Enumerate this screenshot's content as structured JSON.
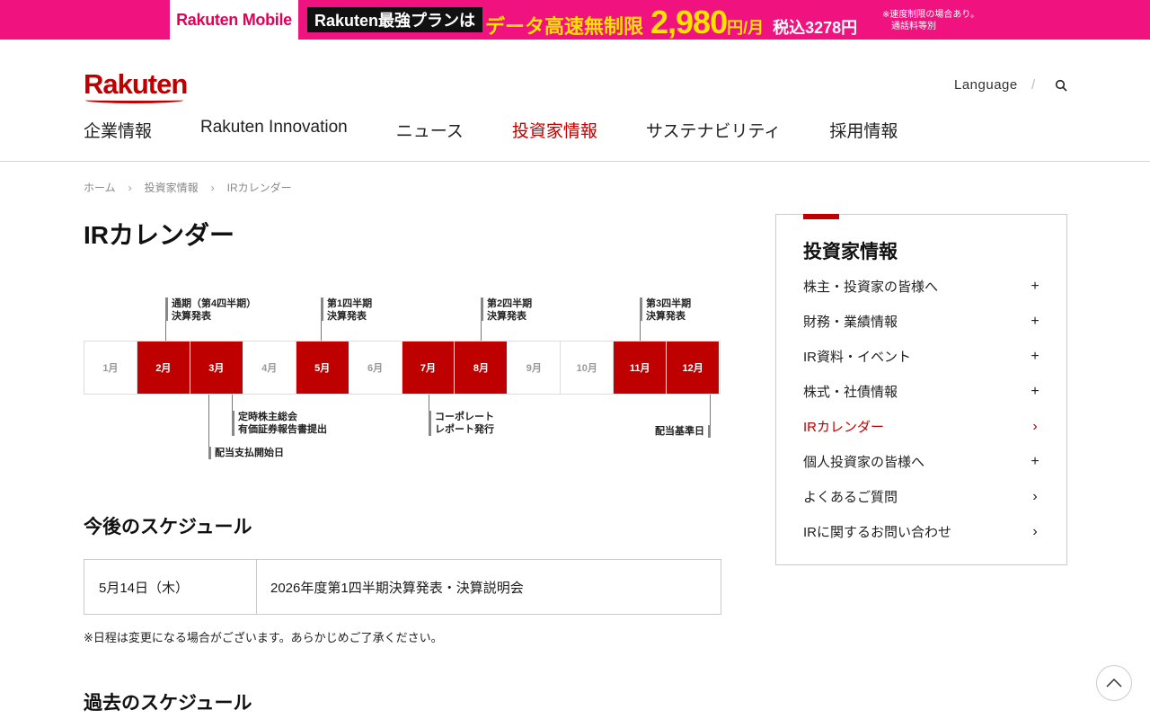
{
  "banner": {
    "brand": "Rakuten Mobile",
    "plan": "Rakuten最強プランは",
    "promo_text": "データ高速無制限",
    "price": "2,980",
    "price_unit": "円/月",
    "tax": "税込3278円",
    "note_line1": "※速度制限の場合あり。",
    "note_line2": "通話料等別",
    "background_color": "#f0127e"
  },
  "header": {
    "logo": "Rakuten",
    "language": "Language",
    "nav": [
      {
        "label": "企業情報"
      },
      {
        "label": "Rakuten Innovation"
      },
      {
        "label": "ニュース"
      },
      {
        "label": "投資家情報"
      },
      {
        "label": "サステナビリティ"
      },
      {
        "label": "採用情報"
      }
    ],
    "accent_color": "#bf0000"
  },
  "breadcrumb": [
    "ホーム",
    "投資家情報",
    "IRカレンダー"
  ],
  "page_title": "IRカレンダー",
  "calendar": {
    "months": [
      "1月",
      "2月",
      "3月",
      "4月",
      "5月",
      "6月",
      "7月",
      "8月",
      "9月",
      "10月",
      "11月",
      "12月"
    ],
    "events_top": [
      {
        "line1": "通期（第4四半期）",
        "line2": "決算発表"
      },
      {
        "line1": "第1四半期",
        "line2": "決算発表"
      },
      {
        "line1": "第2四半期",
        "line2": "決算発表"
      },
      {
        "line1": "第3四半期",
        "line2": "決算発表"
      }
    ],
    "events_bottom": [
      {
        "line1": "定時株主総会",
        "line2": "有価証券報告書提出"
      },
      {
        "line1": "配当支払開始日"
      },
      {
        "line1": "コーポレート",
        "line2": "レポート発行"
      },
      {
        "line1": "配当基準日"
      }
    ]
  },
  "upcoming": {
    "heading": "今後のスケジュール",
    "rows": [
      {
        "date": "5月14日（木）",
        "desc": "2026年度第1四半期決算発表・決算説明会"
      }
    ],
    "notice": "※日程は変更になる場合がございます。あらかじめご了承ください。"
  },
  "past": {
    "heading": "過去のスケジュール"
  },
  "sidebar": {
    "title": "投資家情報",
    "items": [
      {
        "label": "株主・投資家の皆様へ",
        "mark": "+"
      },
      {
        "label": "財務・業績情報",
        "mark": "+"
      },
      {
        "label": "IR資料・イベント",
        "mark": "+"
      },
      {
        "label": "株式・社債情報",
        "mark": "+"
      },
      {
        "label": "IRカレンダー",
        "mark": "›"
      },
      {
        "label": "個人投資家の皆様へ",
        "mark": "+"
      },
      {
        "label": "よくあるご質問",
        "mark": "›"
      },
      {
        "label": "IRに関するお問い合わせ",
        "mark": "›"
      }
    ]
  }
}
